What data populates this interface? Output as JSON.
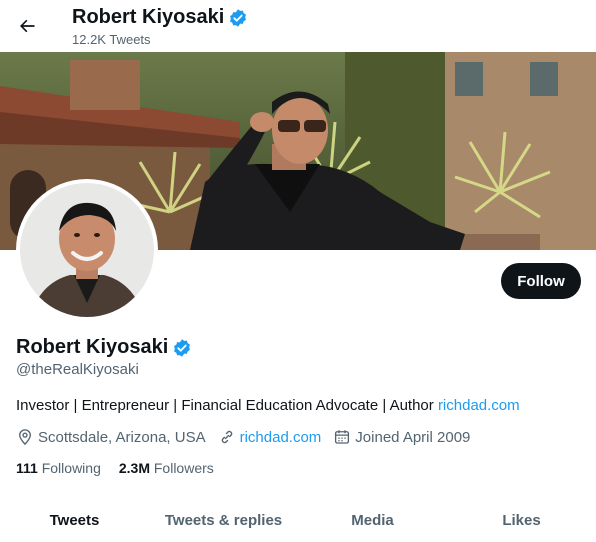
{
  "header": {
    "name": "Robert Kiyosaki",
    "tweet_count": "12.2K Tweets"
  },
  "profile": {
    "name": "Robert Kiyosaki",
    "handle": "@theRealKiyosaki",
    "bio_text": "Investor | Entrepreneur | Financial Education Advocate | Author ",
    "bio_link": "richdad.com",
    "location": "Scottsdale, Arizona, USA",
    "website": "richdad.com",
    "joined": "Joined April 2009",
    "following_count": "111",
    "following_label": "Following",
    "followers_count": "2.3M",
    "followers_label": "Followers",
    "follow_button": "Follow"
  },
  "tabs": [
    {
      "label": "Tweets",
      "active": true
    },
    {
      "label": "Tweets & replies",
      "active": false
    },
    {
      "label": "Media",
      "active": false
    },
    {
      "label": "Likes",
      "active": false
    }
  ],
  "icons": {
    "back": "arrow-left-icon",
    "verified": "verified-badge-icon",
    "location": "location-pin-icon",
    "link": "link-icon",
    "calendar": "calendar-icon"
  },
  "colors": {
    "accent": "#1d9bf0",
    "text": "#0f1419",
    "secondary": "#536471",
    "follow_bg": "#0f1419"
  }
}
